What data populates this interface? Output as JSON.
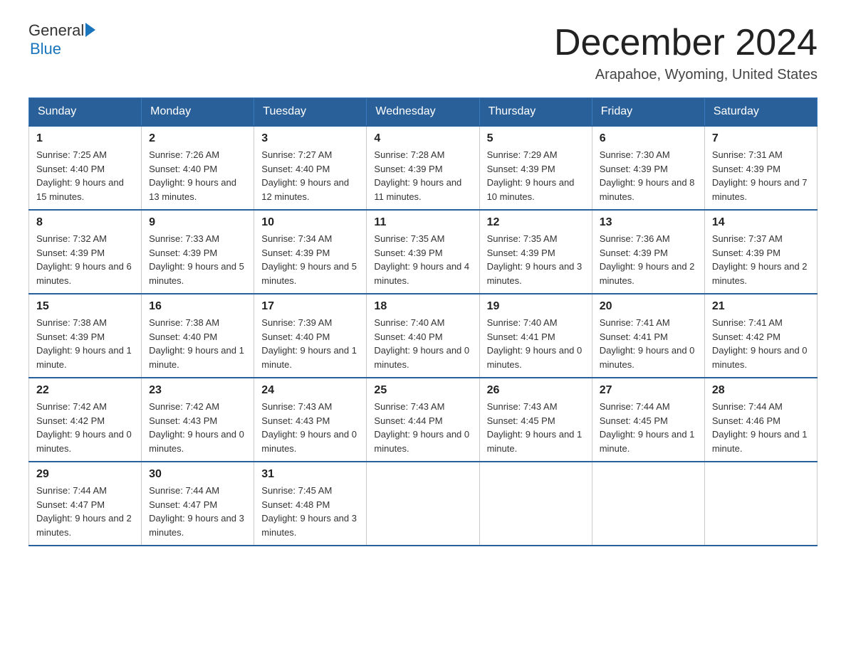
{
  "header": {
    "logo_line1": "General",
    "logo_line2": "Blue",
    "title": "December 2024",
    "subtitle": "Arapahoe, Wyoming, United States"
  },
  "days_of_week": [
    "Sunday",
    "Monday",
    "Tuesday",
    "Wednesday",
    "Thursday",
    "Friday",
    "Saturday"
  ],
  "weeks": [
    [
      {
        "day": "1",
        "sunrise": "7:25 AM",
        "sunset": "4:40 PM",
        "daylight": "9 hours and 15 minutes."
      },
      {
        "day": "2",
        "sunrise": "7:26 AM",
        "sunset": "4:40 PM",
        "daylight": "9 hours and 13 minutes."
      },
      {
        "day": "3",
        "sunrise": "7:27 AM",
        "sunset": "4:40 PM",
        "daylight": "9 hours and 12 minutes."
      },
      {
        "day": "4",
        "sunrise": "7:28 AM",
        "sunset": "4:39 PM",
        "daylight": "9 hours and 11 minutes."
      },
      {
        "day": "5",
        "sunrise": "7:29 AM",
        "sunset": "4:39 PM",
        "daylight": "9 hours and 10 minutes."
      },
      {
        "day": "6",
        "sunrise": "7:30 AM",
        "sunset": "4:39 PM",
        "daylight": "9 hours and 8 minutes."
      },
      {
        "day": "7",
        "sunrise": "7:31 AM",
        "sunset": "4:39 PM",
        "daylight": "9 hours and 7 minutes."
      }
    ],
    [
      {
        "day": "8",
        "sunrise": "7:32 AM",
        "sunset": "4:39 PM",
        "daylight": "9 hours and 6 minutes."
      },
      {
        "day": "9",
        "sunrise": "7:33 AM",
        "sunset": "4:39 PM",
        "daylight": "9 hours and 5 minutes."
      },
      {
        "day": "10",
        "sunrise": "7:34 AM",
        "sunset": "4:39 PM",
        "daylight": "9 hours and 5 minutes."
      },
      {
        "day": "11",
        "sunrise": "7:35 AM",
        "sunset": "4:39 PM",
        "daylight": "9 hours and 4 minutes."
      },
      {
        "day": "12",
        "sunrise": "7:35 AM",
        "sunset": "4:39 PM",
        "daylight": "9 hours and 3 minutes."
      },
      {
        "day": "13",
        "sunrise": "7:36 AM",
        "sunset": "4:39 PM",
        "daylight": "9 hours and 2 minutes."
      },
      {
        "day": "14",
        "sunrise": "7:37 AM",
        "sunset": "4:39 PM",
        "daylight": "9 hours and 2 minutes."
      }
    ],
    [
      {
        "day": "15",
        "sunrise": "7:38 AM",
        "sunset": "4:39 PM",
        "daylight": "9 hours and 1 minute."
      },
      {
        "day": "16",
        "sunrise": "7:38 AM",
        "sunset": "4:40 PM",
        "daylight": "9 hours and 1 minute."
      },
      {
        "day": "17",
        "sunrise": "7:39 AM",
        "sunset": "4:40 PM",
        "daylight": "9 hours and 1 minute."
      },
      {
        "day": "18",
        "sunrise": "7:40 AM",
        "sunset": "4:40 PM",
        "daylight": "9 hours and 0 minutes."
      },
      {
        "day": "19",
        "sunrise": "7:40 AM",
        "sunset": "4:41 PM",
        "daylight": "9 hours and 0 minutes."
      },
      {
        "day": "20",
        "sunrise": "7:41 AM",
        "sunset": "4:41 PM",
        "daylight": "9 hours and 0 minutes."
      },
      {
        "day": "21",
        "sunrise": "7:41 AM",
        "sunset": "4:42 PM",
        "daylight": "9 hours and 0 minutes."
      }
    ],
    [
      {
        "day": "22",
        "sunrise": "7:42 AM",
        "sunset": "4:42 PM",
        "daylight": "9 hours and 0 minutes."
      },
      {
        "day": "23",
        "sunrise": "7:42 AM",
        "sunset": "4:43 PM",
        "daylight": "9 hours and 0 minutes."
      },
      {
        "day": "24",
        "sunrise": "7:43 AM",
        "sunset": "4:43 PM",
        "daylight": "9 hours and 0 minutes."
      },
      {
        "day": "25",
        "sunrise": "7:43 AM",
        "sunset": "4:44 PM",
        "daylight": "9 hours and 0 minutes."
      },
      {
        "day": "26",
        "sunrise": "7:43 AM",
        "sunset": "4:45 PM",
        "daylight": "9 hours and 1 minute."
      },
      {
        "day": "27",
        "sunrise": "7:44 AM",
        "sunset": "4:45 PM",
        "daylight": "9 hours and 1 minute."
      },
      {
        "day": "28",
        "sunrise": "7:44 AM",
        "sunset": "4:46 PM",
        "daylight": "9 hours and 1 minute."
      }
    ],
    [
      {
        "day": "29",
        "sunrise": "7:44 AM",
        "sunset": "4:47 PM",
        "daylight": "9 hours and 2 minutes."
      },
      {
        "day": "30",
        "sunrise": "7:44 AM",
        "sunset": "4:47 PM",
        "daylight": "9 hours and 3 minutes."
      },
      {
        "day": "31",
        "sunrise": "7:45 AM",
        "sunset": "4:48 PM",
        "daylight": "9 hours and 3 minutes."
      },
      null,
      null,
      null,
      null
    ]
  ]
}
